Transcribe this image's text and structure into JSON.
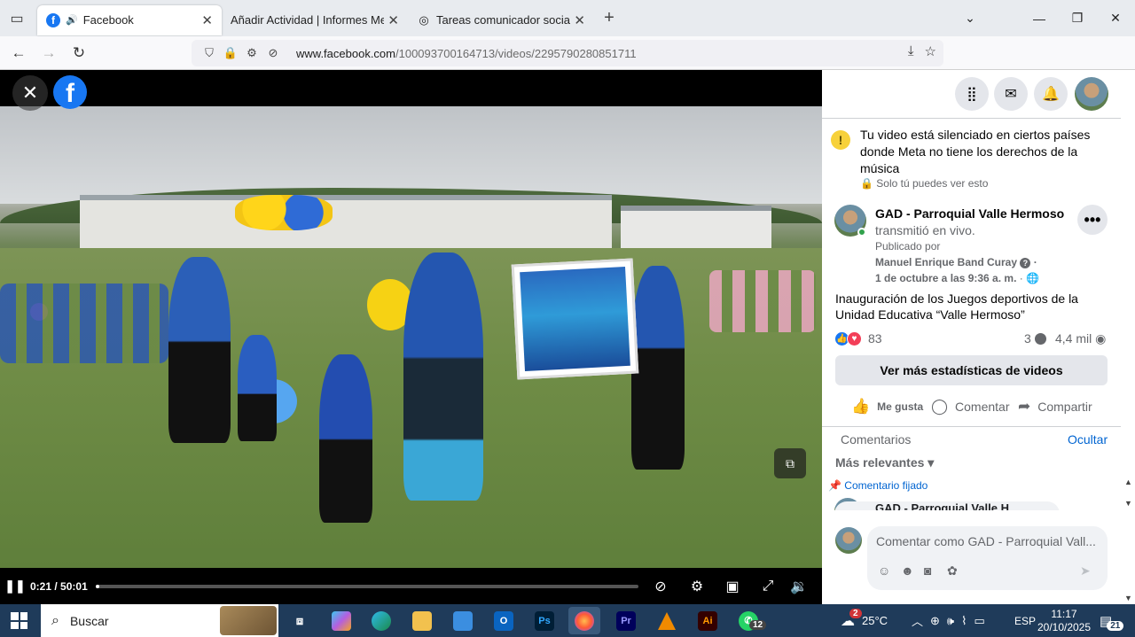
{
  "browser": {
    "tabs": [
      {
        "title": "Facebook",
        "active": true
      },
      {
        "title": "Añadir Actividad | Informes Mensua",
        "active": false
      },
      {
        "title": "Tareas comunicador social GAD",
        "active": false
      }
    ],
    "url_host": "www.facebook.com",
    "url_path": "/100093700164713/videos/2295790280851711"
  },
  "video": {
    "current_time": "0:21",
    "duration": "50:01",
    "progress_fraction": 0.007
  },
  "panel": {
    "notice": {
      "text": "Tu video está silenciado en ciertos países donde Meta no tiene los derechos de la música",
      "privacy": "Solo tú puedes ver esto"
    },
    "post": {
      "page_name": "GAD - Parroquial Valle Hermoso",
      "live_text": "transmitió en vivo.",
      "published_by": "Publicado por",
      "author": "Manuel Enrique Band Curay",
      "author_sep": "·",
      "date": "1 de octubre a las 9:36 a. m.",
      "date_sep": "·",
      "description": "Inauguración de los Juegos deportivos de la Unidad Educativa “Valle Hermoso”",
      "reactions_count": "83",
      "comments_count": "3",
      "views": "4,4 mil"
    },
    "stats_button": "Ver más estadísticas de videos",
    "actions": {
      "like": "Me gusta",
      "comment": "Comentar",
      "share": "Compartir"
    },
    "comments": {
      "label": "Comentarios",
      "hide": "Ocultar",
      "sort": "Más relevantes",
      "pinned": "Comentario fijado",
      "pinned_preview": "GAD - Parroquial Valle H..."
    },
    "composer_placeholder": "Comentar como GAD - Parroquial Vall..."
  },
  "taskbar": {
    "search": "Buscar",
    "weather": "25°C",
    "weather_badge": "2",
    "language": "ESP",
    "time": "11:17",
    "date": "20/10/2025",
    "notifications": "21",
    "whatsapp_badge": "12"
  },
  "colors": {
    "facebook_blue": "#1877f2",
    "link_blue": "#0064d1",
    "taskbar": "#1f3b5a"
  }
}
